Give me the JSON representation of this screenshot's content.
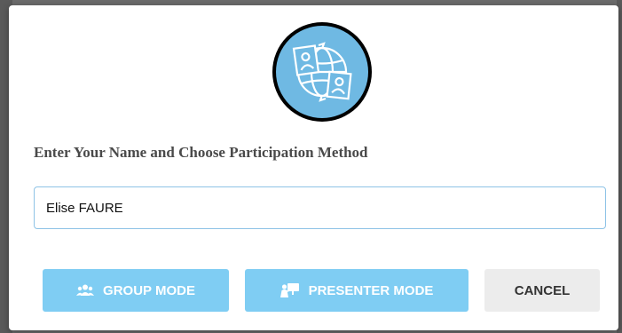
{
  "dialog": {
    "logo_icon": "globe-video-conference-icon",
    "prompt_text": "Enter Your Name and Choose Participation Method",
    "name_field": {
      "value": "Elise FAURE",
      "placeholder": ""
    },
    "buttons": {
      "group_mode": {
        "label": "GROUP MODE",
        "icon": "group-users-icon"
      },
      "presenter_mode": {
        "label": "PRESENTER MODE",
        "icon": "presenter-board-icon"
      },
      "cancel": {
        "label": "CANCEL"
      }
    },
    "colors": {
      "accent": "#7fcdf3",
      "logo_fill": "#6fb9e3",
      "cancel_bg": "#ececec"
    }
  }
}
